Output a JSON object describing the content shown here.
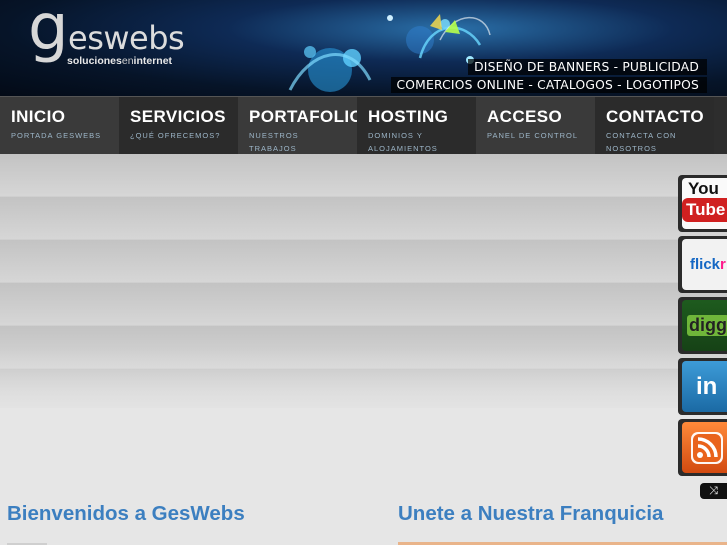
{
  "header": {
    "logo_g": "g",
    "logo_word": "eswebs",
    "logo_tag_pre": "soluciones",
    "logo_tag_en": "en",
    "logo_tag_post": "internet",
    "tagline_line1": "DISEÑO DE BANNERS - PUBLICIDAD",
    "tagline_line2": "COMERCIOS ONLINE - CATALOGOS - LOGOTIPOS"
  },
  "nav": {
    "items": [
      {
        "title": "INICIO",
        "subtitle": "PORTADA GESWEBS"
      },
      {
        "title": "SERVICIOS",
        "subtitle": "¿QUÉ OFRECEMOS?"
      },
      {
        "title": "PORTAFOLIO",
        "subtitle": "NUESTROS TRABAJOS"
      },
      {
        "title": "HOSTING",
        "subtitle": "DOMINIOS Y ALOJAMIENTOS"
      },
      {
        "title": "ACCESO",
        "subtitle": "PANEL DE CONTROL"
      },
      {
        "title": "CONTACTO",
        "subtitle": "CONTACTA CON NOSOTROS"
      }
    ]
  },
  "social": {
    "youtube_you": "You",
    "youtube_tube": "Tube",
    "flickr_a": "flick",
    "flickr_b": "r",
    "digg": "digg",
    "linkedin": "in",
    "icons": [
      "youtube-icon",
      "flickr-icon",
      "digg-icon",
      "linkedin-icon",
      "rss-icon",
      "shuffle-icon"
    ]
  },
  "content": {
    "left_heading": "Bienvenidos a GesWebs",
    "right_heading": "Unete a Nuestra Franquicia"
  },
  "colors": {
    "accent_blue": "#3c7fc0",
    "nav_dark": "#2d2d2d",
    "nav_light": "#3a3a3a",
    "nav_sub": "#9db6c8",
    "rule_orange": "#e9b48a"
  }
}
